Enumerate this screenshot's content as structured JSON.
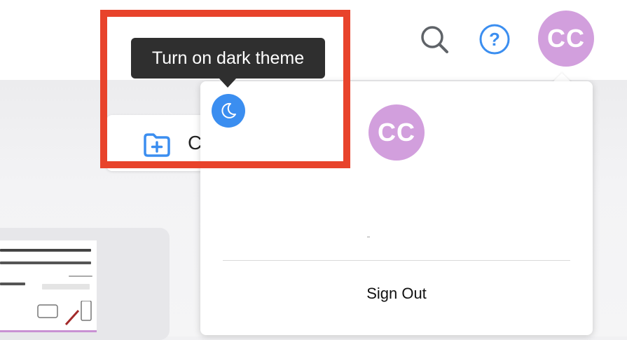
{
  "header": {
    "search_icon": "search-icon",
    "help_icon": "help-icon",
    "avatar_initials": "CC"
  },
  "colors": {
    "avatar_bg": "#d29fdd",
    "accent_blue": "#3b8ef0",
    "highlight_red": "#e8432b",
    "tooltip_bg": "#2f2f2f"
  },
  "tooltip": {
    "text": "Turn on dark theme"
  },
  "menu": {
    "dark_theme_icon": "moon-icon",
    "avatar_initials": "CC",
    "sign_out_label": "Sign Out"
  },
  "background": {
    "new_folder_icon": "folder-plus-icon",
    "new_folder_label": "C"
  }
}
